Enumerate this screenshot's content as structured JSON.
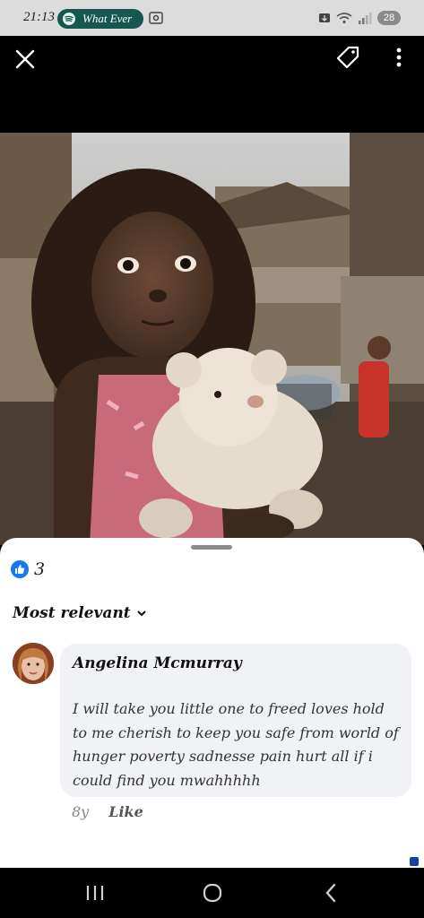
{
  "status_bar": {
    "time": "21:13",
    "spotify_label": "What Ever",
    "battery": "28"
  },
  "post": {
    "reaction_count": "3",
    "sort_label": "Most relevant"
  },
  "comment": {
    "author": "Angelina Mcmurray",
    "text": "I will take you little one to freed loves  hold to me cherish to keep you safe from world of hunger poverty  sadnesse  pain hurt all if i could find you mwahhhhh",
    "age": "8y",
    "like_label": "Like"
  },
  "icons": {
    "close": "close-icon",
    "tag": "tag-icon",
    "more": "more-vertical-icon",
    "like": "thumbs-up-icon",
    "chevron": "chevron-down-icon"
  },
  "colors": {
    "spotify_pill": "#16574f",
    "like_blue": "#1877f2",
    "bubble": "#f0f2f5"
  }
}
